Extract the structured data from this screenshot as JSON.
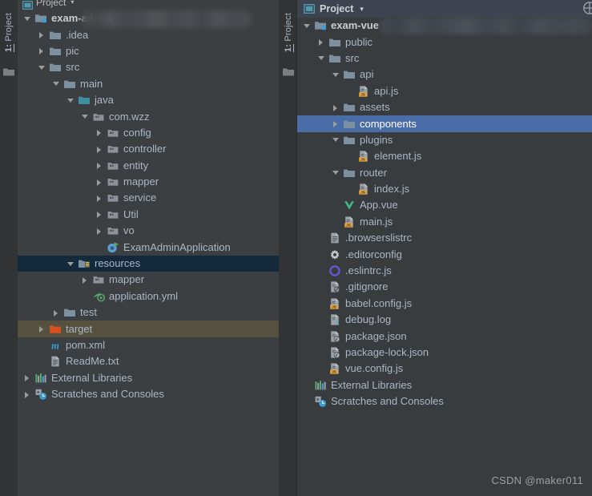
{
  "left_window": {
    "side_tab": {
      "number": "1:",
      "label": "Project",
      "icon": "project-folder-icon"
    },
    "side_tab_right": {
      "number": "1:",
      "label": "Project",
      "icon": "project-folder-icon"
    },
    "header": {
      "title": "Project",
      "icon": "project-window-icon",
      "caret": "▾"
    },
    "redacted_path_label": "",
    "tree": [
      {
        "label": "exam-admin",
        "icon": "module-folder-icon",
        "arrow": "expanded",
        "indent": 0,
        "bold": true,
        "selected": "none"
      },
      {
        "label": ".idea",
        "icon": "folder-icon",
        "arrow": "collapsed",
        "indent": 1,
        "bold": false,
        "selected": "none"
      },
      {
        "label": "pic",
        "icon": "folder-icon",
        "arrow": "collapsed",
        "indent": 1,
        "bold": false,
        "selected": "none"
      },
      {
        "label": "src",
        "icon": "folder-icon",
        "arrow": "expanded",
        "indent": 1,
        "bold": false,
        "selected": "none"
      },
      {
        "label": "main",
        "icon": "folder-icon",
        "arrow": "expanded",
        "indent": 2,
        "bold": false,
        "selected": "none"
      },
      {
        "label": "java",
        "icon": "source-root-icon",
        "arrow": "expanded",
        "indent": 3,
        "bold": false,
        "selected": "none"
      },
      {
        "label": "com.wzz",
        "icon": "package-icon",
        "arrow": "expanded",
        "indent": 4,
        "bold": false,
        "selected": "none"
      },
      {
        "label": "config",
        "icon": "package-icon",
        "arrow": "collapsed",
        "indent": 5,
        "bold": false,
        "selected": "none"
      },
      {
        "label": "controller",
        "icon": "package-icon",
        "arrow": "collapsed",
        "indent": 5,
        "bold": false,
        "selected": "none"
      },
      {
        "label": "entity",
        "icon": "package-icon",
        "arrow": "collapsed",
        "indent": 5,
        "bold": false,
        "selected": "none"
      },
      {
        "label": "mapper",
        "icon": "package-icon",
        "arrow": "collapsed",
        "indent": 5,
        "bold": false,
        "selected": "none"
      },
      {
        "label": "service",
        "icon": "package-icon",
        "arrow": "collapsed",
        "indent": 5,
        "bold": false,
        "selected": "none"
      },
      {
        "label": "Util",
        "icon": "package-icon",
        "arrow": "collapsed",
        "indent": 5,
        "bold": false,
        "selected": "none"
      },
      {
        "label": "vo",
        "icon": "package-icon",
        "arrow": "collapsed",
        "indent": 5,
        "bold": false,
        "selected": "none"
      },
      {
        "label": "ExamAdminApplication",
        "icon": "java-class-run-icon",
        "arrow": "none",
        "indent": 5,
        "bold": false,
        "selected": "none"
      },
      {
        "label": "resources",
        "icon": "resource-root-icon",
        "arrow": "expanded",
        "indent": 3,
        "bold": false,
        "selected": "navy"
      },
      {
        "label": "mapper",
        "icon": "package-icon",
        "arrow": "collapsed",
        "indent": 4,
        "bold": false,
        "selected": "none"
      },
      {
        "label": "application.yml",
        "icon": "spring-yaml-icon",
        "arrow": "none",
        "indent": 4,
        "bold": false,
        "selected": "none"
      },
      {
        "label": "test",
        "icon": "folder-icon",
        "arrow": "collapsed",
        "indent": 2,
        "bold": false,
        "selected": "none"
      },
      {
        "label": "target",
        "icon": "target-folder-icon",
        "arrow": "collapsed",
        "indent": 1,
        "bold": false,
        "selected": "olive"
      },
      {
        "label": "pom.xml",
        "icon": "maven-icon",
        "arrow": "none",
        "indent": 1,
        "bold": false,
        "selected": "none"
      },
      {
        "label": "ReadMe.txt",
        "icon": "text-file-icon",
        "arrow": "none",
        "indent": 1,
        "bold": false,
        "selected": "none"
      },
      {
        "label": "External Libraries",
        "icon": "libraries-icon",
        "arrow": "collapsed",
        "indent": 0,
        "bold": false,
        "selected": "none"
      },
      {
        "label": "Scratches and Consoles",
        "icon": "scratches-icon",
        "arrow": "collapsed",
        "indent": 0,
        "bold": false,
        "selected": "none"
      }
    ]
  },
  "right_window": {
    "header": {
      "title": "Project",
      "icon": "project-window-icon",
      "caret": "▾",
      "corner_icon": "gear-icon"
    },
    "redacted_path_label": "",
    "tree": [
      {
        "label": "exam-vue",
        "icon": "module-folder-icon",
        "arrow": "expanded",
        "indent": 0,
        "bold": true,
        "selected": "none"
      },
      {
        "label": "public",
        "icon": "folder-icon",
        "arrow": "collapsed",
        "indent": 1,
        "bold": false,
        "selected": "none"
      },
      {
        "label": "src",
        "icon": "folder-icon",
        "arrow": "expanded",
        "indent": 1,
        "bold": false,
        "selected": "none"
      },
      {
        "label": "api",
        "icon": "folder-icon",
        "arrow": "expanded",
        "indent": 2,
        "bold": false,
        "selected": "none"
      },
      {
        "label": "api.js",
        "icon": "js-file-icon",
        "arrow": "none",
        "indent": 3,
        "bold": false,
        "selected": "none"
      },
      {
        "label": "assets",
        "icon": "folder-icon",
        "arrow": "collapsed",
        "indent": 2,
        "bold": false,
        "selected": "none"
      },
      {
        "label": "components",
        "icon": "folder-icon",
        "arrow": "collapsed",
        "indent": 2,
        "bold": false,
        "selected": "blue"
      },
      {
        "label": "plugins",
        "icon": "folder-icon",
        "arrow": "expanded",
        "indent": 2,
        "bold": false,
        "selected": "none"
      },
      {
        "label": "element.js",
        "icon": "js-file-icon",
        "arrow": "none",
        "indent": 3,
        "bold": false,
        "selected": "none"
      },
      {
        "label": "router",
        "icon": "folder-icon",
        "arrow": "expanded",
        "indent": 2,
        "bold": false,
        "selected": "none"
      },
      {
        "label": "index.js",
        "icon": "js-file-icon",
        "arrow": "none",
        "indent": 3,
        "bold": false,
        "selected": "none"
      },
      {
        "label": "App.vue",
        "icon": "vue-file-icon",
        "arrow": "none",
        "indent": 2,
        "bold": false,
        "selected": "none"
      },
      {
        "label": "main.js",
        "icon": "js-file-icon",
        "arrow": "none",
        "indent": 2,
        "bold": false,
        "selected": "none"
      },
      {
        "label": ".browserslistrc",
        "icon": "text-file-icon",
        "arrow": "none",
        "indent": 1,
        "bold": false,
        "selected": "none"
      },
      {
        "label": ".editorconfig",
        "icon": "editorconfig-icon",
        "arrow": "none",
        "indent": 1,
        "bold": false,
        "selected": "none"
      },
      {
        "label": ".eslintrc.js",
        "icon": "eslint-icon",
        "arrow": "none",
        "indent": 1,
        "bold": false,
        "selected": "none"
      },
      {
        "label": ".gitignore",
        "icon": "gitignore-icon",
        "arrow": "none",
        "indent": 1,
        "bold": false,
        "selected": "none"
      },
      {
        "label": "babel.config.js",
        "icon": "js-file-icon",
        "arrow": "none",
        "indent": 1,
        "bold": false,
        "selected": "none"
      },
      {
        "label": "debug.log",
        "icon": "unknown-file-icon",
        "arrow": "none",
        "indent": 1,
        "bold": false,
        "selected": "none"
      },
      {
        "label": "package.json",
        "icon": "npm-json-icon",
        "arrow": "none",
        "indent": 1,
        "bold": false,
        "selected": "none"
      },
      {
        "label": "package-lock.json",
        "icon": "npm-json-icon",
        "arrow": "none",
        "indent": 1,
        "bold": false,
        "selected": "none"
      },
      {
        "label": "vue.config.js",
        "icon": "js-file-icon",
        "arrow": "none",
        "indent": 1,
        "bold": false,
        "selected": "none"
      },
      {
        "label": "External Libraries",
        "icon": "libraries-icon",
        "arrow": "none",
        "indent": 0,
        "bold": false,
        "selected": "none"
      },
      {
        "label": "Scratches and Consoles",
        "icon": "scratches-icon",
        "arrow": "none",
        "indent": 0,
        "bold": false,
        "selected": "none"
      }
    ]
  },
  "watermark": "CSDN @maker011",
  "colors": {
    "panel_bg": "#3c3f41",
    "right_panel_bg": "#393c3e",
    "right_header_bg": "#3d4450",
    "selection_blue": "#4a6da7",
    "selection_navy": "#132a3d",
    "selection_olive": "#56513f",
    "text": "#a9b7c6",
    "folder_blue": "#6e8ba6",
    "source_root_teal": "#3f8da0",
    "target_orange": "#d4501e",
    "js_yellow": "#e8a33d"
  }
}
